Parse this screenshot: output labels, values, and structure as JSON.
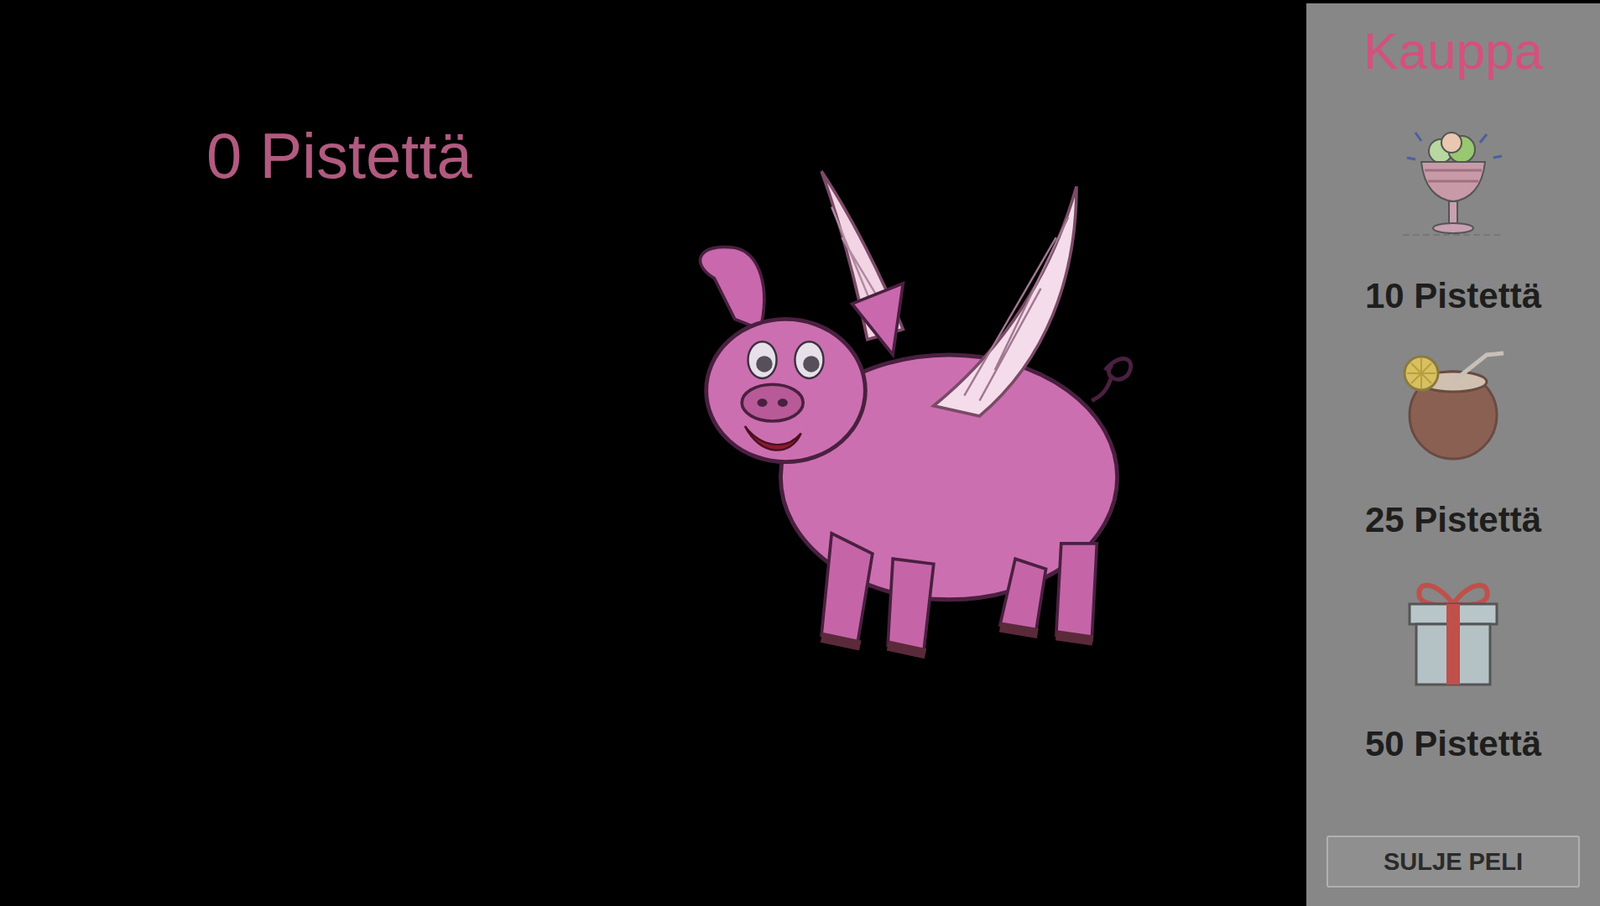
{
  "score": {
    "text": "0 Pistettä"
  },
  "shop": {
    "title": "Kauppa",
    "items": [
      {
        "price": "10 Pistettä",
        "kind": "sundae"
      },
      {
        "price": "25 Pistettä",
        "kind": "coconut"
      },
      {
        "price": "50 Pistettä",
        "kind": "gift"
      }
    ]
  },
  "close_button": {
    "label": "SULJE PELI"
  }
}
